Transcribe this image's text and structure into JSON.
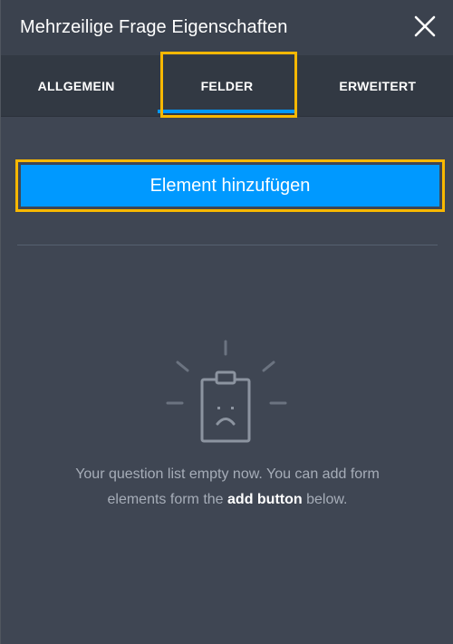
{
  "header": {
    "title": "Mehrzeilige Frage Eigenschaften",
    "close_icon": "close-icon"
  },
  "tabs": [
    {
      "label": "ALLGEMEIN",
      "active": false
    },
    {
      "label": "FELDER",
      "active": true
    },
    {
      "label": "ERWEITERT",
      "active": false
    }
  ],
  "main": {
    "add_button_label": "Element hinzufügen",
    "empty_state": {
      "icon": "sad-clipboard-icon",
      "text_part1": "Your question list empty now. You can add form elements form the",
      "text_bold": "add button",
      "text_part2": "below."
    }
  },
  "colors": {
    "accent": "#0099ff",
    "highlight": "#f9b800",
    "background": "#3f4653"
  }
}
